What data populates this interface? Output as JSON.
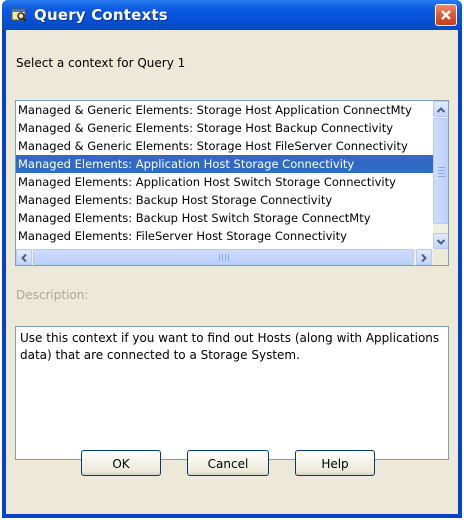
{
  "window": {
    "title": "Query Contexts"
  },
  "prompt": "Select a context for Query 1",
  "contexts": {
    "items": [
      "Managed & Generic Elements: Storage Host Application ConnectMty",
      "Managed & Generic Elements: Storage Host Backup Connectivity",
      "Managed & Generic Elements: Storage Host FileServer Connectivity",
      "Managed Elements: Application Host Storage Connectivity",
      "Managed Elements: Application Host Switch Storage Connectivity",
      "Managed Elements: Backup Host Storage Connectivity",
      "Managed Elements: Backup Host Switch Storage ConnectMty",
      "Managed Elements: FileServer Host Storage Connectivity"
    ],
    "selected_index": 3
  },
  "description": {
    "label": "Description:",
    "text": "Use this context if you want to find out Hosts (along with Applications data) that are connected to a Storage System."
  },
  "buttons": {
    "ok": "OK",
    "cancel": "Cancel",
    "help": "Help"
  },
  "icons": {
    "app": "query-contexts-app-icon",
    "close": "close-icon",
    "scroll_up": "arrow-up-icon",
    "scroll_down": "arrow-down-icon",
    "scroll_left": "arrow-left-icon",
    "scroll_right": "arrow-right-icon"
  },
  "colors": {
    "titlebar": "#0650d6",
    "selection": "#316ac5",
    "dialog_bg": "#ece9d8",
    "close": "#d8512b",
    "disabled_text": "#aca899"
  }
}
